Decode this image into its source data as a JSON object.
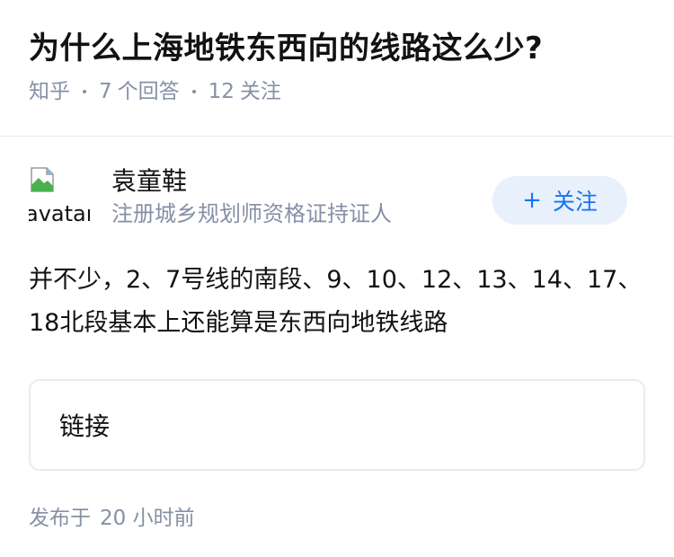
{
  "question": {
    "title": "为什么上海地铁东西向的线路这么少?",
    "source": "知乎",
    "answer_count": "7",
    "answer_label": "个回答",
    "follower_count": "12",
    "follower_label": "关注"
  },
  "answer": {
    "author": {
      "avatar_alt": "avatar",
      "name": "袁童鞋",
      "badge": "注册城乡规划师资格证持证人"
    },
    "follow_button": {
      "icon": "+",
      "label": "关注"
    },
    "content": "并不少，2、7号线的南段、9、10、12、13、14、17、18北段基本上还能算是东西向地铁线路",
    "link_card": {
      "label": "链接"
    },
    "publish": {
      "prefix": "发布于",
      "time": "20 小时前"
    }
  },
  "colors": {
    "accent": "#1772f6",
    "accent_bg": "#e8f1fb",
    "meta_text": "#8590a6",
    "primary_text": "#121212",
    "divider": "#ebebeb"
  }
}
